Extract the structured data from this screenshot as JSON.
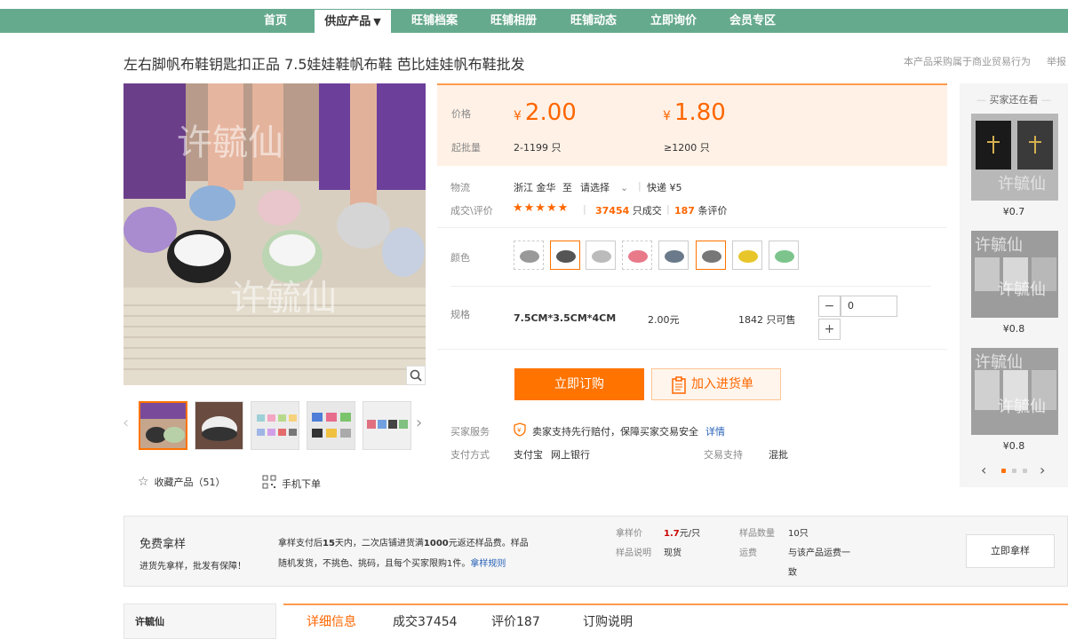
{
  "nav": {
    "items": [
      {
        "label": "首页"
      },
      {
        "label": "供应产品",
        "caret": "▼"
      },
      {
        "label": "旺铺档案"
      },
      {
        "label": "旺铺相册"
      },
      {
        "label": "旺铺动态"
      },
      {
        "label": "立即询价"
      },
      {
        "label": "会员专区"
      }
    ]
  },
  "product": {
    "title": "左右脚帆布鞋钥匙扣正品 7.5娃娃鞋帆布鞋 芭比娃娃帆布鞋批发",
    "purchase_note": "本产品采购属于商业贸易行为",
    "report": "举报",
    "watermark": "许毓仙"
  },
  "price": {
    "price_label": "价格",
    "currency": "¥",
    "tier1_price": "2.00",
    "tier2_price": "1.80",
    "moq_label": "起批量",
    "tier1_range": "2-1199 只",
    "tier2_range": "≥1200 只"
  },
  "logistics": {
    "label": "物流",
    "origin": "浙江 金华",
    "to": "至",
    "dest_placeholder": "请选择",
    "express": "快递 ¥5",
    "deal_label": "成交\\评价",
    "stars": "★★★★★",
    "deals_count": "37454",
    "deals_suffix": "只成交",
    "reviews_count": "187",
    "reviews_suffix": "条评价"
  },
  "color": {
    "label": "颜色"
  },
  "spec": {
    "label": "规格",
    "size": "7.5CM*3.5CM*4CM",
    "price": "2.00元",
    "stock": "1842 只可售",
    "minus": "−",
    "plus": "+",
    "quantity": "0"
  },
  "actions": {
    "buy": "立即订购",
    "cart": "加入进货单"
  },
  "service": {
    "label": "买家服务",
    "text": "卖家支持先行赔付，保障买家交易安全",
    "details_link": "详情",
    "pay_label": "支付方式",
    "pay1": "支付宝",
    "pay2": "网上银行",
    "trade_label": "交易支持",
    "trade_value": "混批"
  },
  "gallery": {
    "favorites": "收藏产品（51）",
    "mobile": "手机下单"
  },
  "sidebar": {
    "title": "买家还在看",
    "items": [
      {
        "price": "¥0.7"
      },
      {
        "price": "¥0.8"
      },
      {
        "price": "¥0.8"
      }
    ]
  },
  "sample": {
    "title": "免费拿样",
    "subtitle": "进货先拿样，批发有保障！",
    "desc_line1_a": "拿样支付后",
    "desc_15": "15",
    "desc_line1_b": "天内，二次店铺进货满",
    "desc_1000": "1000",
    "desc_line1_c": "元返还样品费。样品",
    "desc_line2": "随机发货，不挑色、挑码，且每个买家限购1件。",
    "rules_link": "拿样规则",
    "price_label": "拿样价",
    "price_value": "1.7",
    "price_unit": "元/只",
    "qty_label": "样品数量",
    "qty_value": "10只",
    "note_label": "样品说明",
    "note_value": "现货",
    "ship_label": "运费",
    "ship_value_1": "与该产品运费一",
    "ship_value_2": "致",
    "button": "立即拿样"
  },
  "bottom": {
    "shop_name": "许毓仙",
    "tabs": [
      {
        "label": "详细信息"
      },
      {
        "label": "成交37454"
      },
      {
        "label": "评价187"
      },
      {
        "label": "订购说明"
      }
    ]
  },
  "colors": {
    "accent": "#ff7300",
    "nav_green": "#66aa8e",
    "price_bg": "#fff1e6"
  }
}
